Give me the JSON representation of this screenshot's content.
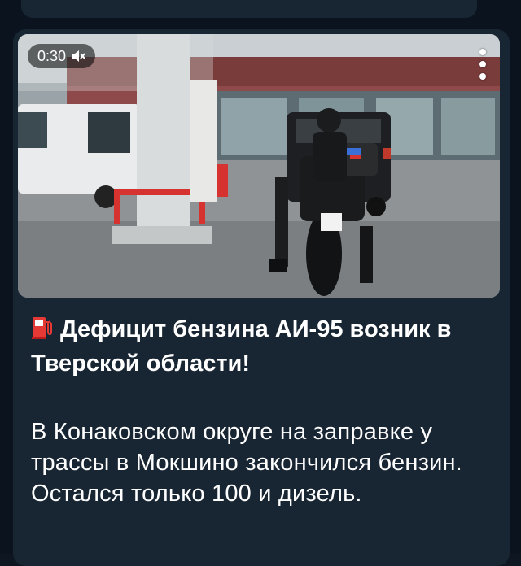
{
  "video": {
    "duration": "0:30",
    "sound_icon": "muted-speaker-icon",
    "menu_icon": "more-vertical-icon"
  },
  "post": {
    "headline_icon": "fuel-pump-icon",
    "headline": "Дефицит бензина АИ-95 возник в Тверской области!",
    "body": "В Конаковском округе на заправке у трассы в Мокшино закончился бензин. Остался только 100 и дизель."
  },
  "colors": {
    "background": "#0b141e",
    "bubble": "#182533",
    "text": "#ffffff",
    "icon_red": "#e53935"
  }
}
